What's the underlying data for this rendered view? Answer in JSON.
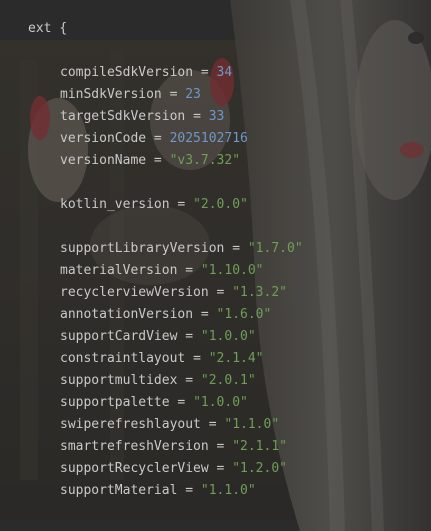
{
  "editor": {
    "block_keyword": "ext",
    "open_brace": "{",
    "assign_op": "=",
    "lines": [
      {
        "name": "compileSdkVersion",
        "value": "34",
        "kind": "num"
      },
      {
        "name": "minSdkVersion",
        "value": "23",
        "kind": "num"
      },
      {
        "name": "targetSdkVersion",
        "value": "33",
        "kind": "num"
      },
      {
        "name": "versionCode",
        "value": "2025102716",
        "kind": "num"
      },
      {
        "name": "versionName",
        "value": "\"v3.7.32\"",
        "kind": "str"
      },
      {
        "name": "kotlin_version",
        "value": "\"2.0.0\"",
        "kind": "str"
      },
      {
        "name": "supportLibraryVersion",
        "value": "\"1.7.0\"",
        "kind": "str"
      },
      {
        "name": "materialVersion",
        "value": "\"1.10.0\"",
        "kind": "str"
      },
      {
        "name": "recyclerviewVersion",
        "value": "\"1.3.2\"",
        "kind": "str"
      },
      {
        "name": "annotationVersion",
        "value": "\"1.6.0\"",
        "kind": "str"
      },
      {
        "name": "supportCardView",
        "value": "\"1.0.0\"",
        "kind": "str"
      },
      {
        "name": "constraintlayout",
        "value": "\"2.1.4\"",
        "kind": "str"
      },
      {
        "name": "supportmultidex",
        "value": "\"2.0.1\"",
        "kind": "str"
      },
      {
        "name": "supportpalette",
        "value": "\"1.0.0\"",
        "kind": "str"
      },
      {
        "name": "swiperefreshlayout",
        "value": "\"1.1.0\"",
        "kind": "str"
      },
      {
        "name": "smartrefreshVersion",
        "value": "\"2.1.1\"",
        "kind": "str"
      },
      {
        "name": "supportRecyclerView",
        "value": "\"1.2.0\"",
        "kind": "str"
      },
      {
        "name": "supportMaterial",
        "value": "\"1.1.0\"",
        "kind": "str"
      }
    ]
  },
  "colors": {
    "background": "#2b2b2b",
    "identifier": "#c9c9c9",
    "number": "#6e98c8",
    "string": "#6f9f56"
  }
}
